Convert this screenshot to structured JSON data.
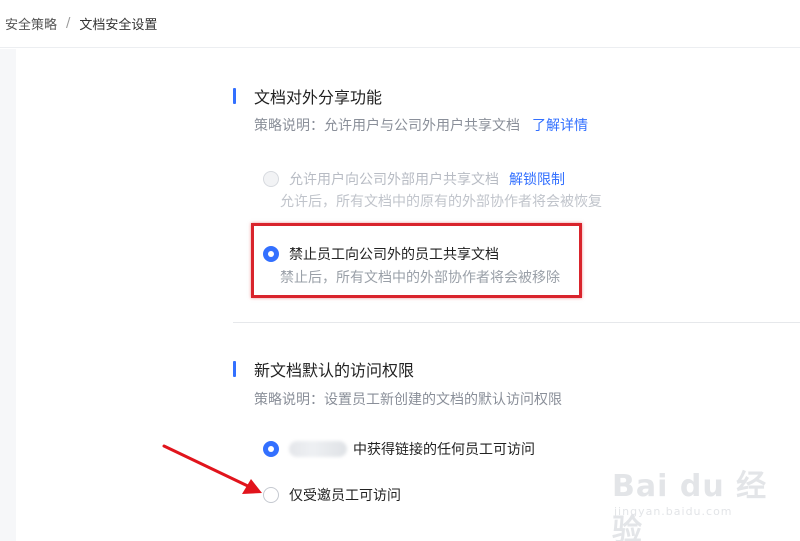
{
  "breadcrumb": {
    "parent": "安全策略",
    "separator": "/",
    "current": "文档安全设置"
  },
  "sections": {
    "external_sharing": {
      "title": "文档对外分享功能",
      "desc_prefix": "策略说明：允许用户与公司外用户共享文档",
      "desc_link": "了解详情",
      "options": [
        {
          "label": "允许用户向公司外部用户共享文档",
          "link": "解锁限制",
          "sub": "允许后，所有文档中的原有的外部协作者将会被恢复",
          "checked": false,
          "disabled": true
        },
        {
          "label": "禁止员工向公司外的员工共享文档",
          "sub": "禁止后，所有文档中的外部协作者将会被移除",
          "checked": true,
          "disabled": false
        }
      ]
    },
    "default_access": {
      "title": "新文档默认的访问权限",
      "desc": "策略说明：设置员工新创建的文档的默认访问权限",
      "options": [
        {
          "label": "中获得链接的任何员工可访问",
          "checked": true
        },
        {
          "label": "仅受邀员工可访问",
          "checked": false
        }
      ]
    }
  },
  "annotations": {
    "highlight_color": "#d9242c",
    "arrow_color": "#e1141c"
  },
  "watermark": {
    "main": "Bai du 经验",
    "sub": "jingyan.baidu.com"
  },
  "colors": {
    "accent": "#3370ff",
    "text": "#222222",
    "muted": "#8a8f99"
  }
}
